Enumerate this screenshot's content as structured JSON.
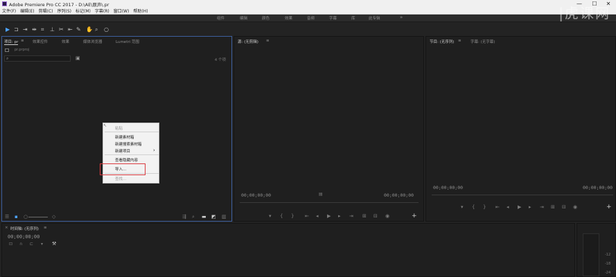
{
  "titlebar": {
    "title": "Adobe Premiere Pro CC 2017 - D:\\AE\\原声\\.pr",
    "minimize": "—",
    "maximize": "☐",
    "close": "✕"
  },
  "menu": [
    "文件(F)",
    "编辑(E)",
    "剪辑(C)",
    "序列(S)",
    "标记(M)",
    "字幕(R)",
    "窗口(W)",
    "帮助(H)"
  ],
  "workspaces": [
    "组件",
    "编辑",
    "颜色",
    "效果",
    "音频",
    "字幕",
    "库",
    "此专辑"
  ],
  "workspaces_more": "»",
  "watermark": "|虎课网",
  "project_panel": {
    "tabs": [
      "项目: pr",
      "效果控件",
      "效果",
      "媒体浏览器",
      "Lumetri 范围"
    ],
    "tab_menu": "≡",
    "file": "pr.prproj",
    "item_count": "4 个项",
    "search_placeholder": ""
  },
  "context_menu": {
    "items": [
      "粘贴",
      "新建素材箱",
      "新建搜索素材箱",
      "新建项目",
      "查看隐藏内容",
      "导入...",
      "查找..."
    ],
    "submenu_arrow": "›"
  },
  "source_panel": {
    "tab": "源: (无剪辑)",
    "timecode": "00;00;00;00"
  },
  "program_panel": {
    "tab": "节目: (无序列)",
    "tab2": "字幕: (无字幕)",
    "timecode_left": "00;00;00;00",
    "timecode_right": "00;00;00;00"
  },
  "timeline_panel": {
    "tab": "时间轴: (无序列)",
    "timecode": "00;00;00;00"
  },
  "meter_labels": [
    "-12",
    "-18",
    "-24"
  ]
}
